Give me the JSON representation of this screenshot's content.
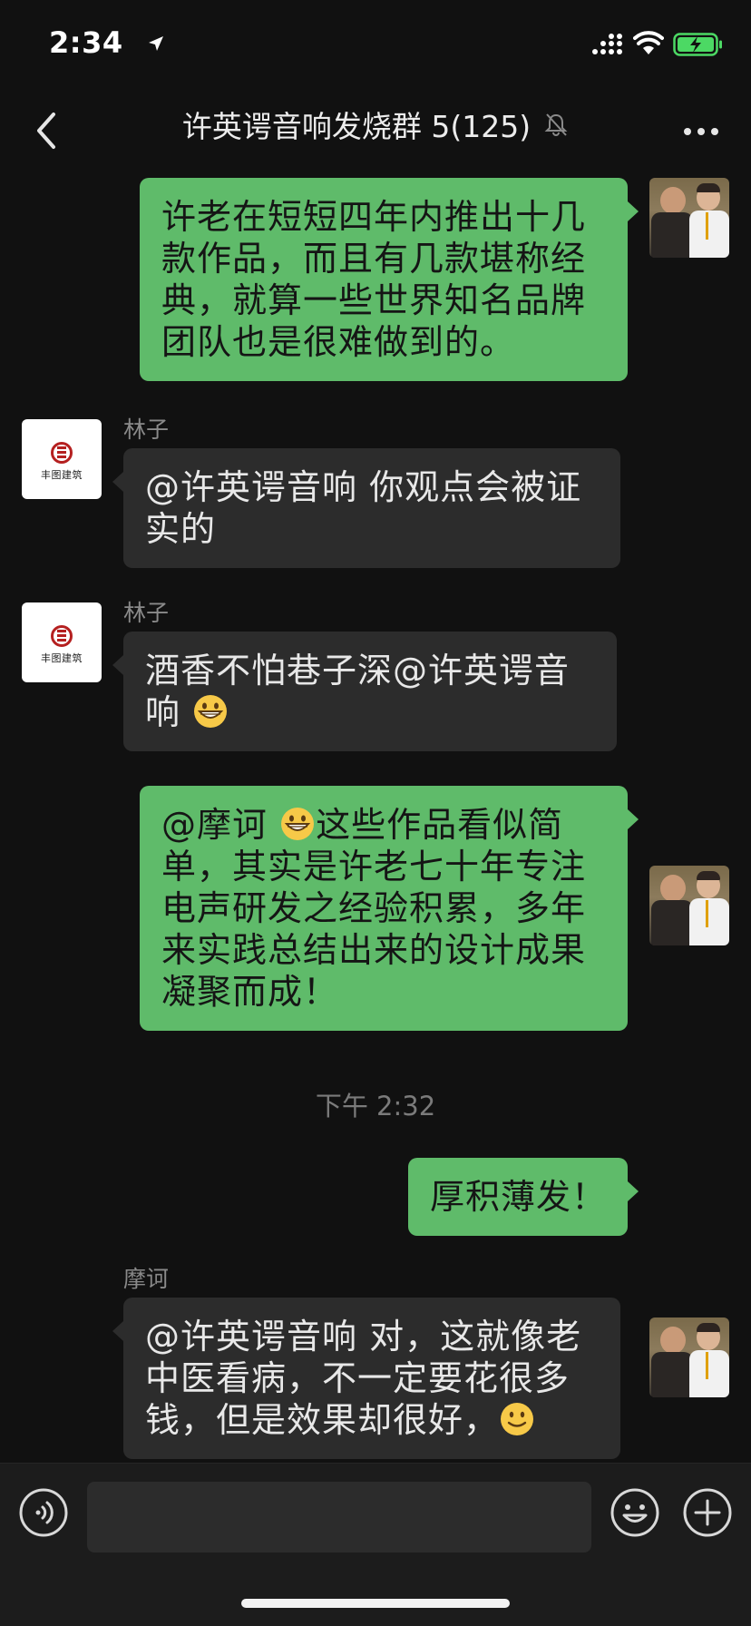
{
  "status_bar": {
    "time": "2:34"
  },
  "nav": {
    "title": "许英谔音响发烧群 5(125)",
    "muted": true
  },
  "messages": [
    {
      "id": "m1",
      "direction": "out",
      "sender": "",
      "text": "许老在短短四年内推出十几款作品，而且有几款堪称经典，就算一些世界知名品牌团队也是很难做到的。"
    },
    {
      "id": "m2",
      "direction": "in",
      "sender": "林子",
      "text": "@许英谔音响 你观点会被证实的"
    },
    {
      "id": "m3",
      "direction": "in",
      "sender": "林子",
      "text_before": "酒香不怕巷子深@许英谔音响 ",
      "emoji": "grinning-face"
    },
    {
      "id": "m4",
      "direction": "out",
      "sender": "",
      "text_before": "@摩诃 ",
      "emoji": "grinning-face",
      "text_after": "这些作品看似简单，其实是许老七十年专注电声研发之经验积累，多年来实践总结出来的设计成果凝聚而成！"
    },
    {
      "id": "m5",
      "direction": "out",
      "sender": "",
      "text": "厚积薄发！"
    },
    {
      "id": "m6",
      "direction": "in",
      "sender": "摩诃",
      "text_before": "@许英谔音响 对，这就像老中医看病，不一定要花很多钱，但是效果却很好，",
      "emoji": "smiling-face"
    }
  ],
  "timestamp": "下午 2:32",
  "logo_text": "丰图建筑",
  "input": {
    "value": ""
  },
  "colors": {
    "background": "#111111",
    "bubble_out": "#5fbb6a",
    "bubble_in": "#2c2c2c",
    "battery": "#4cd964"
  }
}
